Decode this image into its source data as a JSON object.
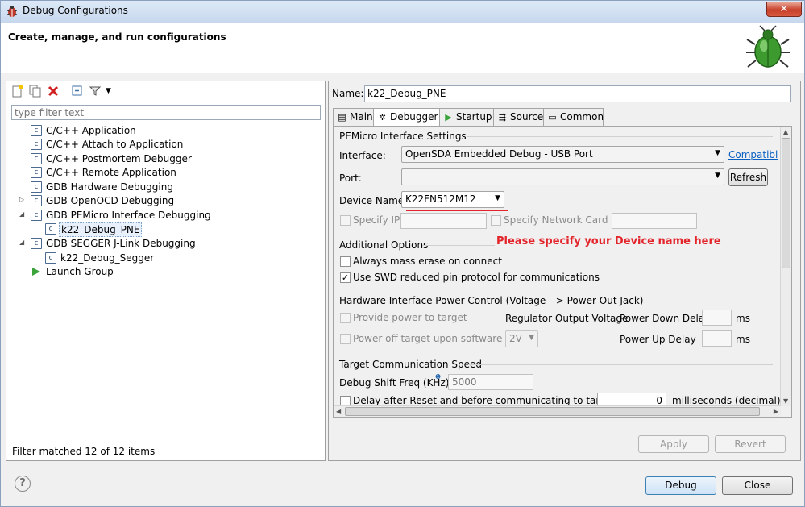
{
  "window": {
    "title": "Debug Configurations",
    "close_label": "✕"
  },
  "header": {
    "heading": "Create, manage, and run configurations"
  },
  "left": {
    "filter_placeholder": "type filter text",
    "tree": [
      {
        "label": "C/C++ Application",
        "icon": "c-config-icon"
      },
      {
        "label": "C/C++ Attach to Application",
        "icon": "c-config-icon"
      },
      {
        "label": "C/C++ Postmortem Debugger",
        "icon": "c-config-icon"
      },
      {
        "label": "C/C++ Remote Application",
        "icon": "c-config-icon"
      },
      {
        "label": "GDB Hardware Debugging",
        "icon": "c-config-icon"
      },
      {
        "label": "GDB OpenOCD Debugging",
        "icon": "c-config-icon"
      },
      {
        "label": "GDB PEMicro Interface Debugging",
        "icon": "c-config-icon"
      },
      {
        "label": "k22_Debug_PNE",
        "icon": "c-config-icon"
      },
      {
        "label": "GDB SEGGER J-Link Debugging",
        "icon": "c-config-icon"
      },
      {
        "label": "k22_Debug_Segger",
        "icon": "c-config-icon"
      },
      {
        "label": "Launch Group",
        "icon": "play-icon"
      }
    ],
    "filter_status": "Filter matched 12 of 12 items"
  },
  "right": {
    "name_label": "Name:",
    "name_value": "k22_Debug_PNE",
    "tabs": [
      {
        "label": "Main",
        "icon": "main-tab-icon"
      },
      {
        "label": "Debugger",
        "icon": "bug-tab-icon"
      },
      {
        "label": "Startup",
        "icon": "play-icon"
      },
      {
        "label": "Source",
        "icon": "source-icon"
      },
      {
        "label": "Common",
        "icon": "common-icon"
      }
    ],
    "pemicro": {
      "group_title": "PEMicro Interface Settings",
      "interface_label": "Interface:",
      "interface_value": "OpenSDA Embedded Debug - USB Port",
      "compat_link": "Compatibl",
      "port_label": "Port:",
      "port_value": "",
      "refresh_label": "Refresh",
      "device_label": "Device Name:",
      "device_value": "K22FN512M12",
      "specify_ip_label": "Specify IP",
      "specify_network_label": "Specify Network Card IP",
      "annotation": "Please specify your Device name here"
    },
    "options": {
      "group_title": "Additional Options",
      "mass_erase_label": "Always mass erase on connect",
      "swd_label": "Use SWD reduced pin protocol for communications",
      "swd_checked": "✓"
    },
    "power": {
      "group_title": "Hardware Interface Power Control (Voltage --> Power-Out Jack)",
      "provide_power_label": "Provide power to target",
      "regulator_label": "Regulator Output Voltage",
      "power_down_label": "Power Down Delay",
      "ms1": "ms",
      "power_off_label": "Power off target upon software exit",
      "voltage_value": "2V",
      "power_up_label": "Power Up Delay",
      "ms2": "ms"
    },
    "speed": {
      "group_title": "Target Communication Speed",
      "shift_label": "Debug Shift Freq (KHz)",
      "shift_value": "5000",
      "delay_label": "Delay after Reset and before communicating to target for",
      "delay_value": "0",
      "delay_unit": "milliseconds (decimal)"
    },
    "apply_label": "Apply",
    "revert_label": "Revert"
  },
  "footer": {
    "help_label": "?",
    "debug_label": "Debug",
    "close_label": "Close"
  }
}
